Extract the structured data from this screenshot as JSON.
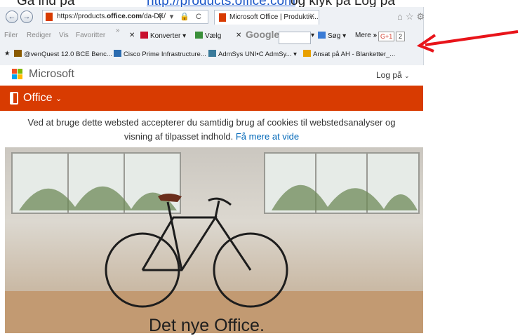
{
  "doc": {
    "pre": "Gå ind på",
    "link": "http://products.office.com",
    "post": "og klyk på Log på"
  },
  "browser": {
    "url_prefix": "https://products.",
    "url_bold": "office.com",
    "url_suffix": "/da-DK/",
    "tab_title": "Microsoft Office | Produktiv...",
    "menu": [
      "Filer",
      "Rediger",
      "Vis",
      "Favoritter"
    ],
    "toolbar": {
      "convert": "Konverter",
      "select": "Vælg",
      "google": "Google",
      "search": "Søg",
      "more": "Mere",
      "plus_one": "G+1",
      "count": "2"
    },
    "favorites": [
      "@venQuest 12.0 BCE Benc...",
      "Cisco Prime Infrastructure...",
      "AdmSys UNI•C AdmSy...",
      "Ansat på AH - Blanketter_..."
    ]
  },
  "page": {
    "brand": "Microsoft",
    "login": "Log på",
    "product": "Office",
    "cookie_line1": "Ved at bruge dette websted accepterer du samtidig brug af cookies til webstedsanalyser og",
    "cookie_line2": "visning af tilpasset indhold.",
    "cookie_more": "Få mere at vide",
    "headline": "Det nye Office."
  },
  "colors": {
    "office_orange": "#d83b01",
    "link_blue": "#0067b8",
    "arrow_red": "#e8141a"
  }
}
